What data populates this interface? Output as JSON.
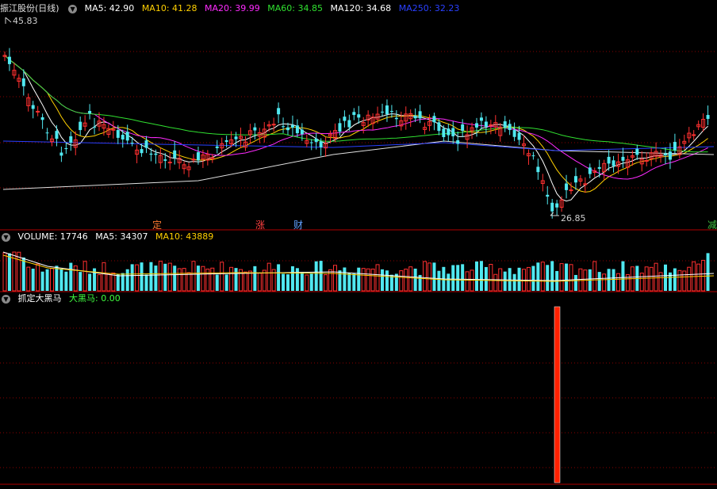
{
  "stock": {
    "name": "振江股份",
    "period": "(日线)"
  },
  "ma_legend": [
    {
      "label": "MA5: 42.90",
      "color": "#ffffff"
    },
    {
      "label": "MA10: 41.28",
      "color": "#ffd000"
    },
    {
      "label": "MA20: 39.99",
      "color": "#ff2bff"
    },
    {
      "label": "MA60: 34.85",
      "color": "#30e030"
    },
    {
      "label": "MA120: 34.68",
      "color": "#ffffff"
    },
    {
      "label": "MA250: 32.23",
      "color": "#2a40ff"
    }
  ],
  "price_high_label": "45.83",
  "price_low_label": "26.85",
  "event_tags": [
    {
      "text": "定",
      "color": "#ff7a30"
    },
    {
      "text": "涨",
      "color": "#ff4040"
    },
    {
      "text": "财",
      "color": "#60a0ff"
    },
    {
      "text": "减",
      "color": "#40c040"
    }
  ],
  "volume_legend": [
    {
      "label": "VOLUME: 17746",
      "color": "#ffffff"
    },
    {
      "label": "MA5: 34307",
      "color": "#ffffff"
    },
    {
      "label": "MA10: 43889",
      "color": "#ffd000"
    }
  ],
  "indicator_legend": [
    {
      "label": "抓定大黑马",
      "color": "#ffffff"
    },
    {
      "label": "大黑马: 0.00",
      "color": "#40ff40"
    }
  ],
  "colors": {
    "up": "#ff3030",
    "down": "#50e8f0",
    "grid": "#8a0000",
    "axis": "#b00000"
  },
  "chart_data": [
    {
      "type": "candlestick",
      "title": "振江股份(日线)",
      "series": [
        {
          "name": "MA5",
          "color": "#ffffff"
        },
        {
          "name": "MA10",
          "color": "#ffd000"
        },
        {
          "name": "MA20",
          "color": "#ff2bff"
        },
        {
          "name": "MA60",
          "color": "#30e030"
        },
        {
          "name": "MA120",
          "color": "#ffffff"
        },
        {
          "name": "MA250",
          "color": "#2a40ff"
        }
      ],
      "annotations": [
        "45.83",
        "26.85"
      ]
    },
    {
      "type": "bar",
      "title": "VOLUME",
      "series": [
        {
          "name": "VOLUME"
        },
        {
          "name": "MA5"
        },
        {
          "name": "MA10"
        }
      ]
    },
    {
      "type": "bar",
      "title": "抓定大黑马",
      "series": [
        {
          "name": "大黑马",
          "values": [
            0.0
          ]
        }
      ]
    }
  ]
}
